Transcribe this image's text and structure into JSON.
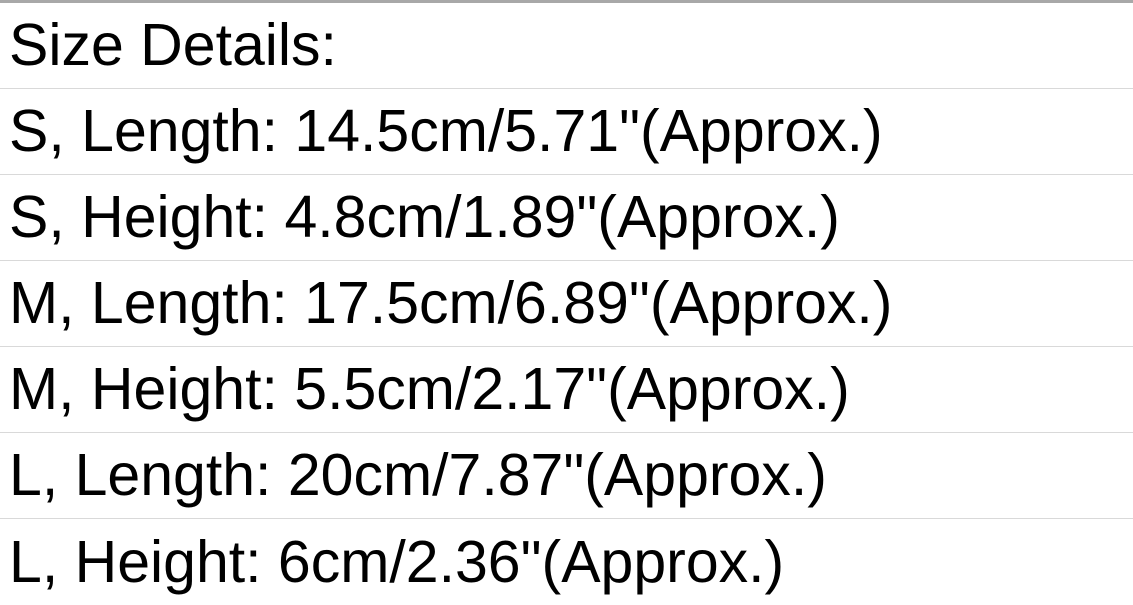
{
  "heading": "Size Details:",
  "rows": [
    "S, Length: 14.5cm/5.71\"(Approx.)",
    "S, Height: 4.8cm/1.89\"(Approx.)",
    "M, Length: 17.5cm/6.89\"(Approx.)",
    "M, Height: 5.5cm/2.17\"(Approx.)",
    "L, Length: 20cm/7.87\"(Approx.)",
    "L, Height: 6cm/2.36\"(Approx.)"
  ]
}
